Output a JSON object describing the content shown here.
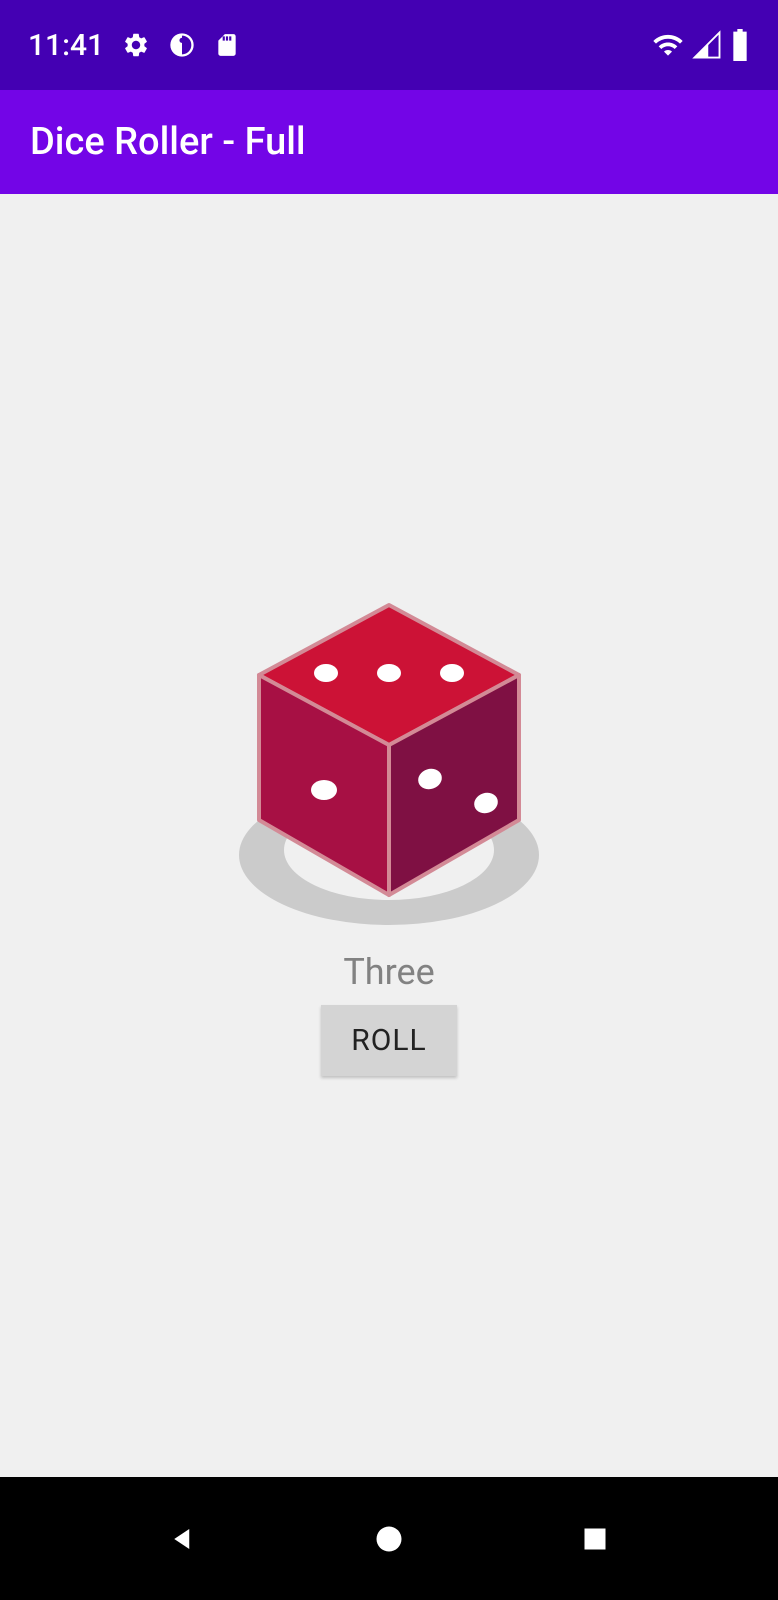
{
  "status_bar": {
    "time": "11:41"
  },
  "app_bar": {
    "title": "Dice Roller - Full"
  },
  "main": {
    "dice_value": 3,
    "dice_label": "Three",
    "roll_button_label": "ROLL"
  },
  "colors": {
    "status_bg": "#4400B3",
    "app_bar_bg": "#7305E7",
    "content_bg": "#F0F0F0",
    "dice_top": "#CC1236",
    "dice_left": "#A71044",
    "dice_right": "#7F1043",
    "dice_edge": "#D38A96",
    "shadow": "#CBCBCB",
    "button_bg": "#D4D4D4"
  }
}
